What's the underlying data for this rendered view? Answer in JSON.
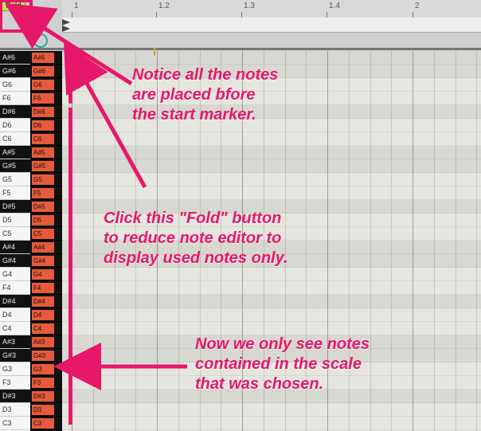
{
  "toolbar": {
    "fold_label": "Fold"
  },
  "ruler": {
    "ticks": [
      "1",
      "1.2",
      "1.3",
      "1.4",
      "2"
    ]
  },
  "keys": [
    {
      "label": "A#6",
      "black": true,
      "note": "A#6"
    },
    {
      "label": "G#6",
      "black": true,
      "note": "G#6"
    },
    {
      "label": "G6",
      "black": false,
      "note": "G6"
    },
    {
      "label": "F6",
      "black": false,
      "note": "F6"
    },
    {
      "label": "D#6",
      "black": true,
      "note": "D#6"
    },
    {
      "label": "D6",
      "black": false,
      "note": "D6"
    },
    {
      "label": "C6",
      "black": false,
      "note": "C6"
    },
    {
      "label": "A#5",
      "black": true,
      "note": "A#5"
    },
    {
      "label": "G#5",
      "black": true,
      "note": "G#5"
    },
    {
      "label": "G5",
      "black": false,
      "note": "G5"
    },
    {
      "label": "F5",
      "black": false,
      "note": "F5"
    },
    {
      "label": "D#5",
      "black": true,
      "note": "D#5"
    },
    {
      "label": "D5",
      "black": false,
      "note": "D5"
    },
    {
      "label": "C5",
      "black": false,
      "note": "C5"
    },
    {
      "label": "A#4",
      "black": true,
      "note": "A#4"
    },
    {
      "label": "G#4",
      "black": true,
      "note": "G#4"
    },
    {
      "label": "G4",
      "black": false,
      "note": "G4"
    },
    {
      "label": "F4",
      "black": false,
      "note": "F4"
    },
    {
      "label": "D#4",
      "black": true,
      "note": "D#4"
    },
    {
      "label": "D4",
      "black": false,
      "note": "D4"
    },
    {
      "label": "C4",
      "black": false,
      "note": "C4"
    },
    {
      "label": "A#3",
      "black": true,
      "note": "A#3"
    },
    {
      "label": "G#3",
      "black": true,
      "note": "G#3"
    },
    {
      "label": "G3",
      "black": false,
      "note": "G3"
    },
    {
      "label": "F3",
      "black": false,
      "note": "F3"
    },
    {
      "label": "D#3",
      "black": true,
      "note": "D#3"
    },
    {
      "label": "D3",
      "black": false,
      "note": "D3"
    },
    {
      "label": "C3",
      "black": false,
      "note": "C3"
    }
  ],
  "annotations": {
    "a1_l1": "Notice all the notes",
    "a1_l2": "are placed bfore",
    "a1_l3": "the start marker.",
    "a2_l1": "Click this \"Fold\" button",
    "a2_l2": "to reduce note editor to",
    "a2_l3": "display used notes only.",
    "a3_l1": "Now we only see notes",
    "a3_l2": "contained in the scale",
    "a3_l3": "that was chosen."
  },
  "colors": {
    "accent": "#e5186a",
    "note": "#e75a3c",
    "fold_bg": "#c8e25a"
  }
}
